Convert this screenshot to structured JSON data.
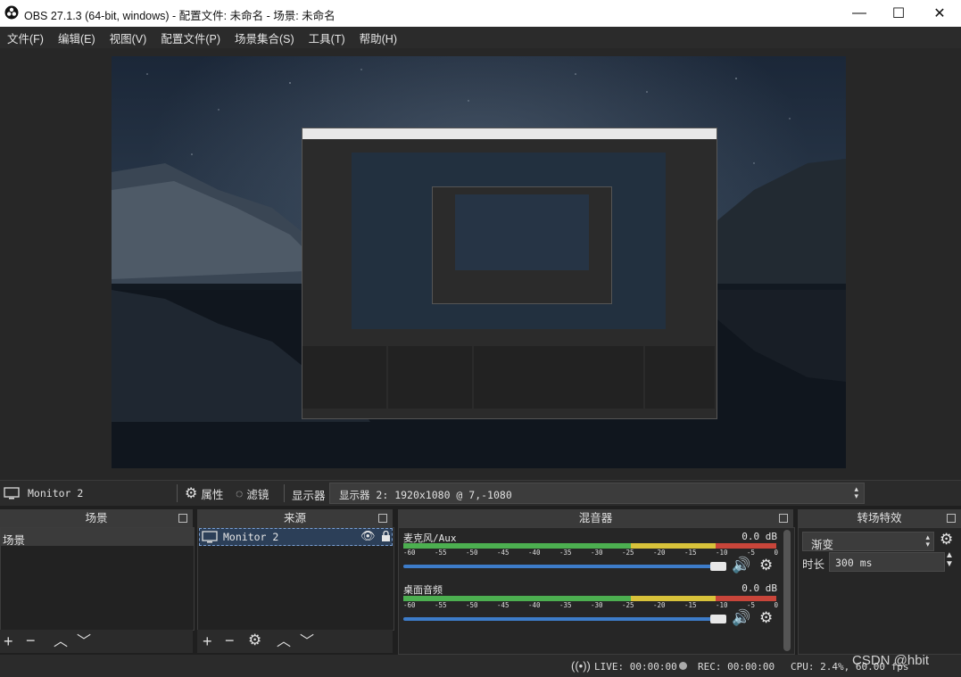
{
  "window": {
    "title": "OBS 27.1.3 (64-bit, windows) - 配置文件: 未命名 - 场景: 未命名",
    "minimize": "—",
    "maximize": "☐",
    "close": "✕"
  },
  "menu": [
    "文件(F)",
    "编辑(E)",
    "视图(V)",
    "配置文件(P)",
    "场景集合(S)",
    "工具(T)",
    "帮助(H)"
  ],
  "source_toolbar": {
    "source_name": "Monitor 2",
    "properties": "属性",
    "filters": "滤镜",
    "display_label": "显示器",
    "display_value": "显示器 2: 1920x1080 @ 7,-1080"
  },
  "docks": {
    "scenes": {
      "title": "场景",
      "items": [
        "场景"
      ]
    },
    "sources": {
      "title": "来源",
      "items": [
        "Monitor 2"
      ]
    },
    "mixer": {
      "title": "混音器",
      "channels": [
        {
          "name": "麦克风/Aux",
          "level": "0.0 dB"
        },
        {
          "name": "桌面音频",
          "level": "0.0 dB"
        }
      ],
      "scale": [
        "-60",
        "-55",
        "-50",
        "-45",
        "-40",
        "-35",
        "-30",
        "-25",
        "-20",
        "-15",
        "-10",
        "-5",
        "0"
      ]
    },
    "transitions": {
      "title": "转场特效",
      "type": "渐变",
      "duration_label": "时长",
      "duration_value": "300 ms"
    }
  },
  "status": {
    "live": "LIVE: 00:00:00",
    "rec": "REC: 00:00:00",
    "cpu": "CPU: 2.4%, 60.00 fps",
    "watermark": "CSDN @hbit"
  },
  "colors": {
    "accent": "#3d7cc9",
    "meter_green": "#4caf50",
    "meter_yellow": "#d8c23a",
    "meter_red": "#c8453a"
  }
}
